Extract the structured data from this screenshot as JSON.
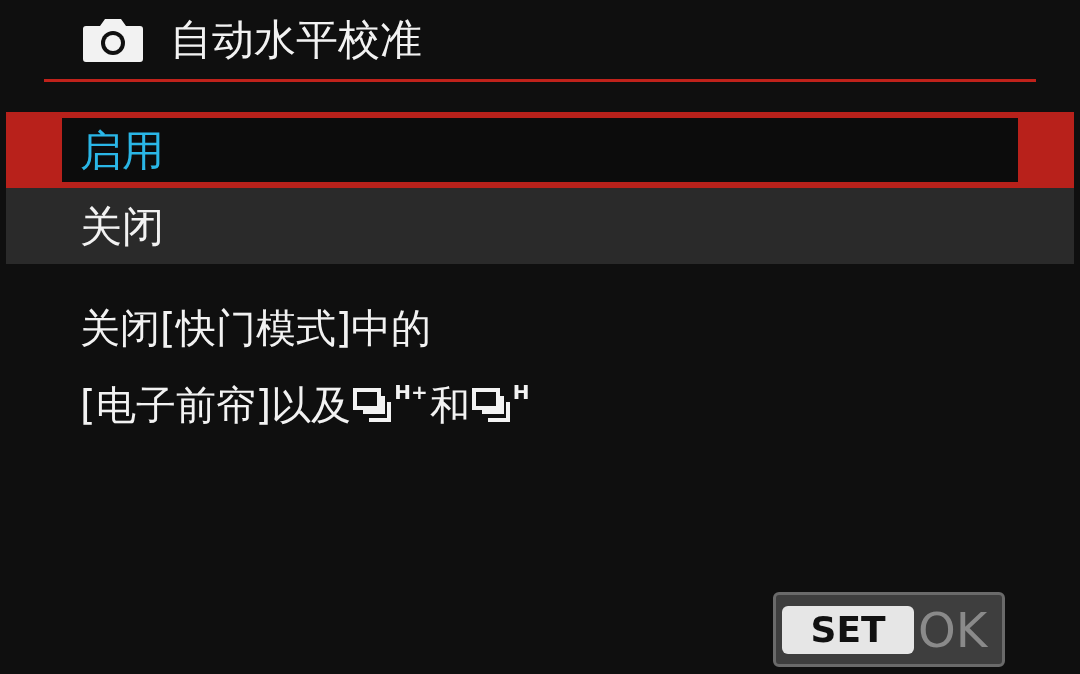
{
  "header": {
    "title": "自动水平校准"
  },
  "options": [
    {
      "label": "启用",
      "selected": true
    },
    {
      "label": "关闭",
      "selected": false
    }
  ],
  "note": [
    [
      {
        "kind": "text",
        "text": "关闭[快门模式]中的"
      }
    ],
    [
      {
        "kind": "text",
        "text": "[电子前帘]以及"
      },
      {
        "kind": "drive",
        "text": "H+"
      },
      {
        "kind": "text",
        "text": "和"
      },
      {
        "kind": "drive",
        "text": "H"
      }
    ]
  ],
  "button": {
    "key": "SET",
    "label": "OK"
  }
}
